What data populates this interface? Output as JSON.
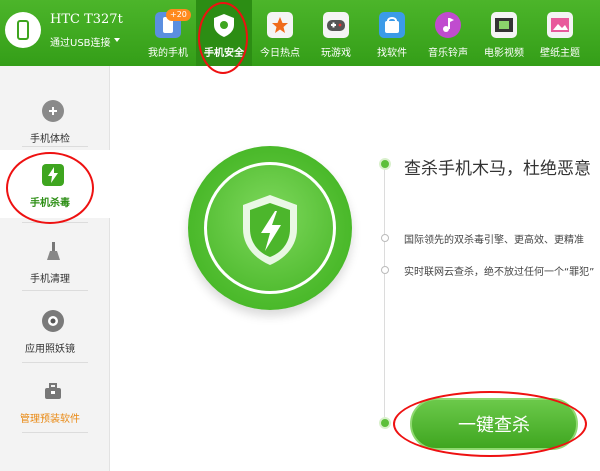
{
  "device": {
    "name": "HTC T327t",
    "connection": "通过USB连接"
  },
  "nav": {
    "items": [
      {
        "label": "我的手机",
        "icon": "phone-icon",
        "badge": "20"
      },
      {
        "label": "手机安全",
        "icon": "shield-icon"
      },
      {
        "label": "今日热点",
        "icon": "star-icon"
      },
      {
        "label": "玩游戏",
        "icon": "gamepad-icon"
      },
      {
        "label": "找软件",
        "icon": "bag-icon"
      },
      {
        "label": "音乐铃声",
        "icon": "music-icon"
      },
      {
        "label": "电影视频",
        "icon": "film-icon"
      },
      {
        "label": "壁纸主题",
        "icon": "picture-icon"
      }
    ]
  },
  "sidebar": {
    "items": [
      {
        "label": "手机体检",
        "icon": "plus-circle-icon"
      },
      {
        "label": "手机杀毒",
        "icon": "shield-icon"
      },
      {
        "label": "手机清理",
        "icon": "broom-icon"
      },
      {
        "label": "应用照妖镜",
        "icon": "lens-icon"
      },
      {
        "label": "管理预装软件",
        "icon": "toolbox-icon"
      }
    ]
  },
  "main": {
    "headline": "查杀手机木马，杜绝恶意",
    "features": [
      "国际领先的双杀毒引擎、更高效、更精准",
      "实时联网云查杀，绝不放过任何一个“罪犯”"
    ],
    "scan_button": "一键查杀"
  },
  "colors": {
    "brand_green": "#3ea51f",
    "annotation_red": "#e11111"
  }
}
